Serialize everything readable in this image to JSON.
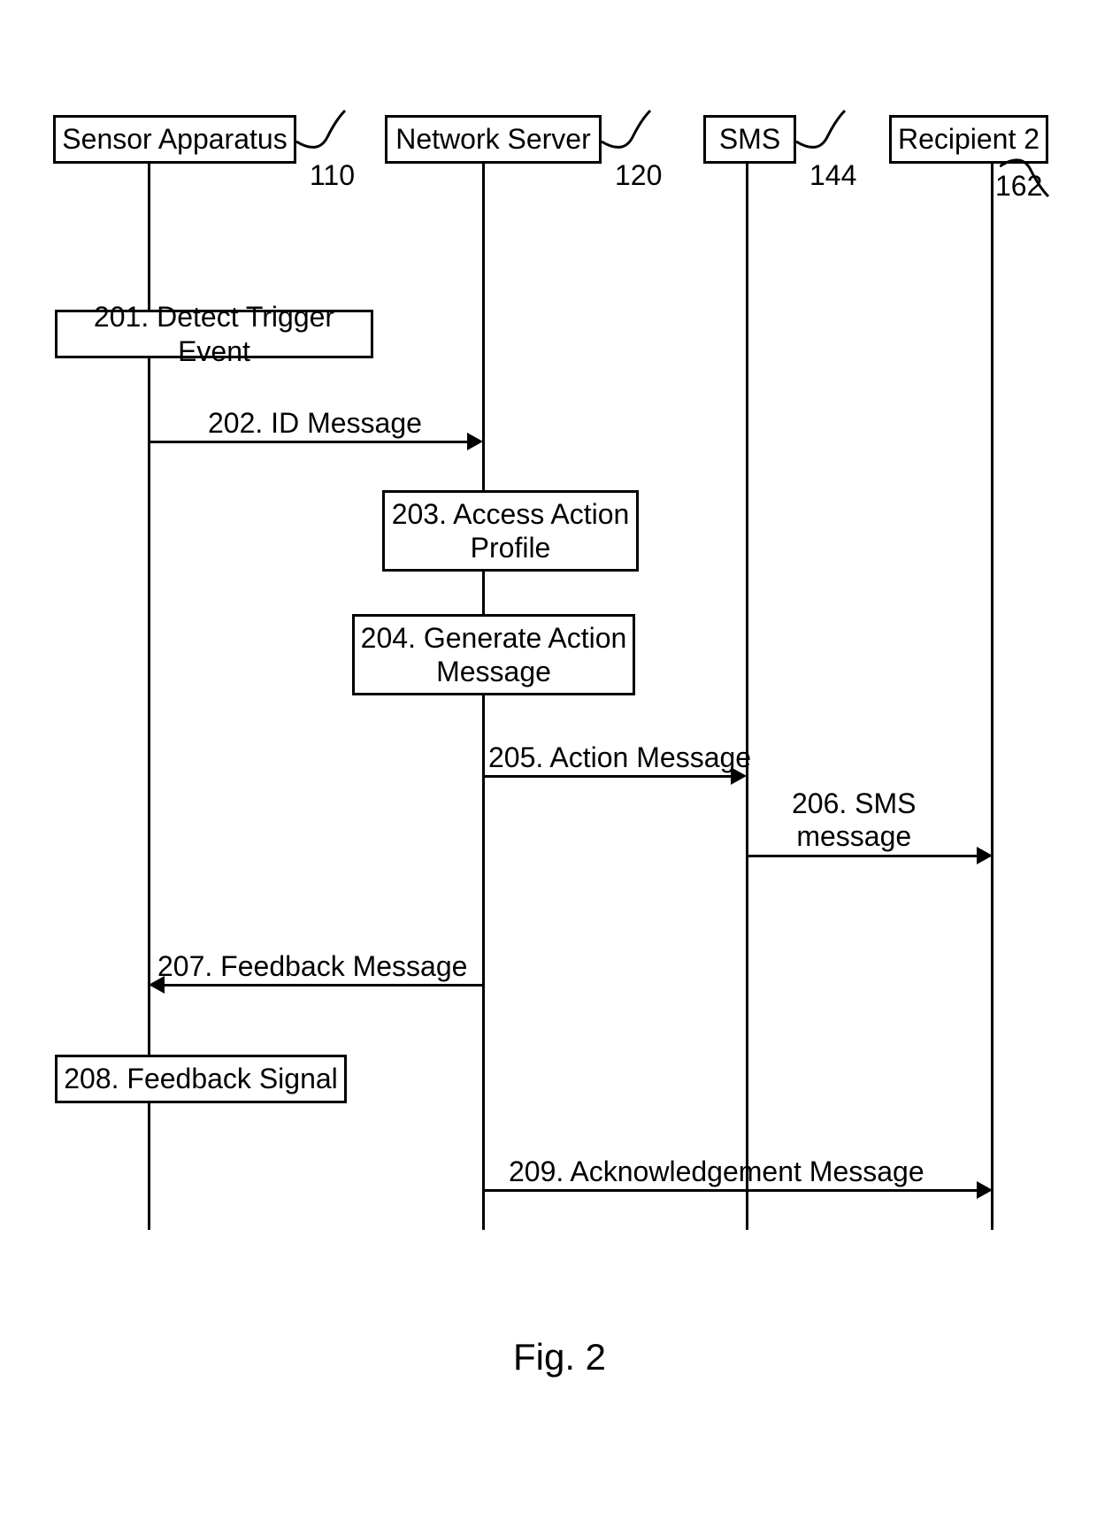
{
  "actors": {
    "sensor": {
      "label": "Sensor Apparatus",
      "ref": "110"
    },
    "server": {
      "label": "Network Server",
      "ref": "120"
    },
    "sms": {
      "label": "SMS",
      "ref": "144"
    },
    "recipient": {
      "label": "Recipient 2",
      "ref": "162"
    }
  },
  "steps": {
    "s201": "201. Detect Trigger Event",
    "s202": "202. ID Message",
    "s203": "203. Access Action\nProfile",
    "s204": "204. Generate Action\nMessage",
    "s205": "205. Action Message",
    "s206": "206. SMS\nmessage",
    "s207": "207. Feedback Message",
    "s208": "208. Feedback Signal",
    "s209": "209. Acknowledgement Message"
  },
  "figure": "Fig. 2",
  "chart_data": {
    "type": "sequence-diagram",
    "actors": [
      {
        "id": "sensor",
        "name": "Sensor Apparatus",
        "ref": "110"
      },
      {
        "id": "server",
        "name": "Network Server",
        "ref": "120"
      },
      {
        "id": "sms",
        "name": "SMS",
        "ref": "144"
      },
      {
        "id": "recipient",
        "name": "Recipient 2",
        "ref": "162"
      }
    ],
    "messages": [
      {
        "step": 201,
        "label": "Detect Trigger Event",
        "at": "sensor",
        "kind": "self-action"
      },
      {
        "step": 202,
        "label": "ID Message",
        "from": "sensor",
        "to": "server",
        "kind": "message"
      },
      {
        "step": 203,
        "label": "Access Action Profile",
        "at": "server",
        "kind": "self-action"
      },
      {
        "step": 204,
        "label": "Generate Action Message",
        "at": "server",
        "kind": "self-action"
      },
      {
        "step": 205,
        "label": "Action Message",
        "from": "server",
        "to": "sms",
        "kind": "message"
      },
      {
        "step": 206,
        "label": "SMS message",
        "from": "sms",
        "to": "recipient",
        "kind": "message"
      },
      {
        "step": 207,
        "label": "Feedback Message",
        "from": "server",
        "to": "sensor",
        "kind": "message"
      },
      {
        "step": 208,
        "label": "Feedback Signal",
        "at": "sensor",
        "kind": "self-action"
      },
      {
        "step": 209,
        "label": "Acknowledgement Message",
        "from": "server",
        "to": "recipient",
        "kind": "message"
      }
    ]
  }
}
